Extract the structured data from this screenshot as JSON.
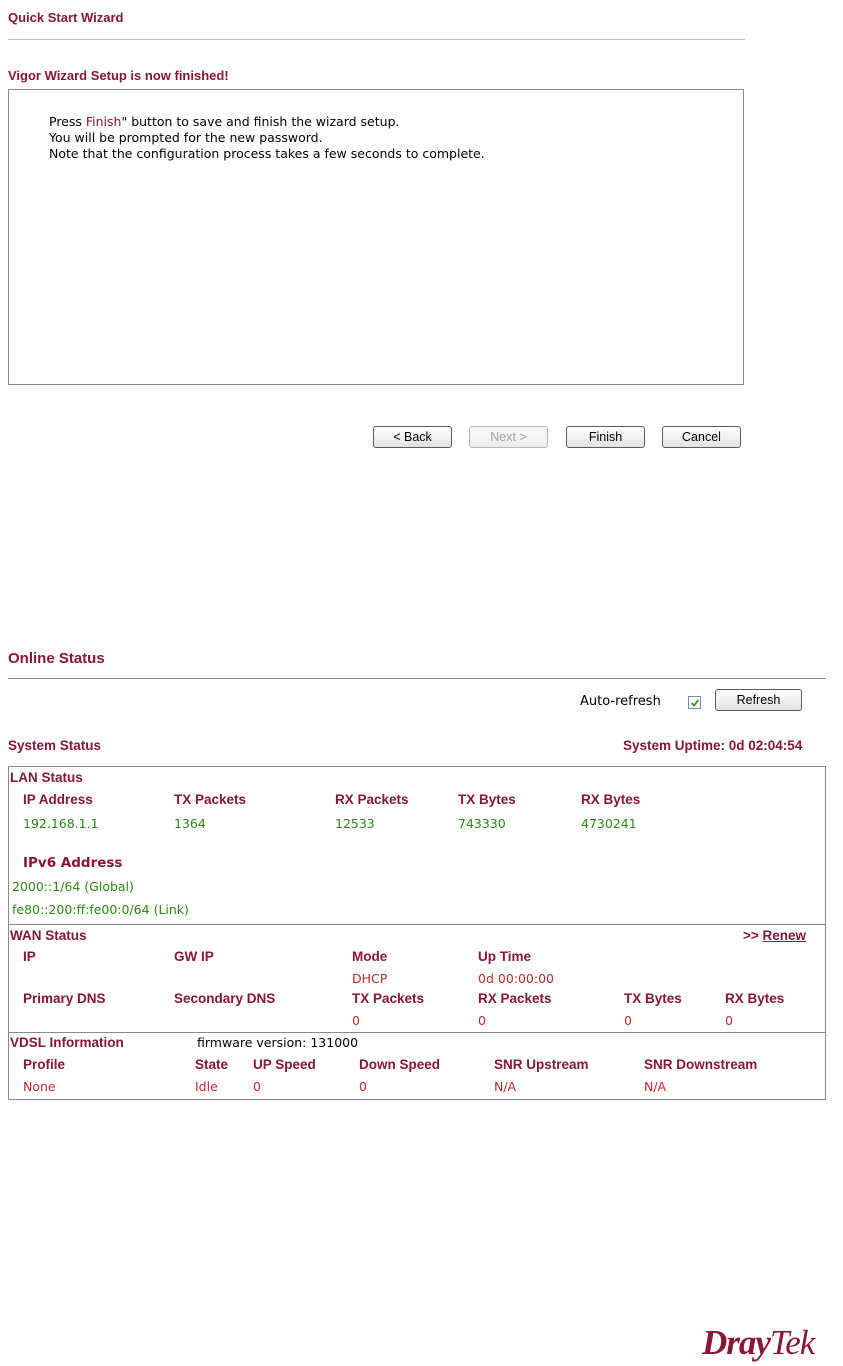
{
  "wizard": {
    "title": "Quick Start Wizard",
    "subtitle": "Vigor Wizard Setup is now finished!",
    "message": {
      "line1_pre": "Press ",
      "line1_highlight": "Finish",
      "line1_post": "\" button to save and finish the wizard setup.",
      "line2": "You will be prompted for the new password.",
      "line3": "Note that the configuration process takes a few seconds to complete."
    },
    "buttons": {
      "back": "< Back",
      "next": "Next >",
      "finish": "Finish",
      "cancel": "Cancel"
    }
  },
  "online_status": {
    "title": "Online Status",
    "auto_refresh_label": "Auto-refresh",
    "auto_refresh_checked": true,
    "refresh_button": "Refresh",
    "system_status_label": "System Status",
    "system_uptime": "System Uptime: 0d 02:04:54",
    "lan": {
      "label": "LAN Status",
      "headers": [
        "IP Address",
        "TX Packets",
        "RX Packets",
        "TX Bytes",
        "RX Bytes"
      ],
      "values": [
        "192.168.1.1",
        "1364",
        "12533",
        "743330",
        "4730241"
      ],
      "ipv6_label": "IPv6 Address",
      "ipv6_global": "2000::1/64 (Global)",
      "ipv6_link": "fe80::200:ff:fe00:0/64 (Link)"
    },
    "wan": {
      "label": "WAN Status",
      "renew_prefix": ">> ",
      "renew_link": "Renew",
      "row1_headers": [
        "IP",
        "GW IP",
        "Mode",
        "Up Time"
      ],
      "row1_values": [
        "",
        "",
        "DHCP",
        "0d 00:00:00"
      ],
      "row2_headers": [
        "Primary DNS",
        "Secondary DNS",
        "TX Packets",
        "RX Packets",
        "TX Bytes",
        "RX Bytes"
      ],
      "row2_values": [
        "",
        "",
        "0",
        "0",
        "0",
        "0"
      ]
    },
    "vdsl": {
      "label": "VDSL Information",
      "firmware": "firmware version: 131000",
      "headers": [
        "Profile",
        "State",
        "UP Speed",
        "Down Speed",
        "SNR Upstream",
        "SNR Downstream"
      ],
      "values": [
        "None",
        "Idle",
        "0",
        "0",
        "N/A",
        "N/A"
      ]
    }
  },
  "branding": {
    "logo_part1": "Dray",
    "logo_part2": "Tek",
    "brand_color": "#8a1538"
  }
}
